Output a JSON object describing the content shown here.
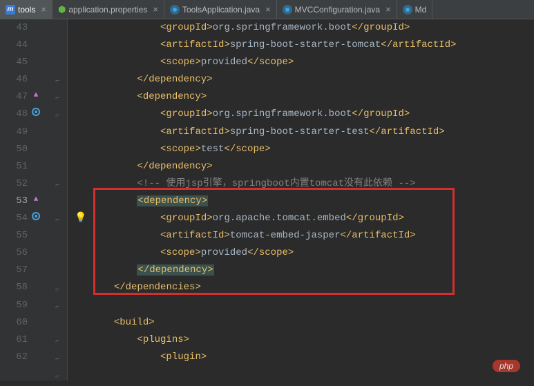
{
  "tabs": [
    {
      "label": "tools",
      "icon": "m"
    },
    {
      "label": "application.properties",
      "icon": "leaf"
    },
    {
      "label": "ToolsApplication.java",
      "icon": "java"
    },
    {
      "label": "MVCConfiguration.java",
      "icon": "java"
    },
    {
      "label": "Md",
      "icon": "java"
    }
  ],
  "gutter": {
    "start": 43,
    "end": 62,
    "current": 53
  },
  "code": {
    "l43": {
      "indent": "                    ",
      "tag_open": "<groupId>",
      "text": "org.springframework.boot",
      "tag_close": "</groupId>"
    },
    "l44": {
      "indent": "                    ",
      "tag_open": "<artifactId>",
      "text": "spring-boot-starter-tomcat",
      "tag_close": "</artifactId>"
    },
    "l45": {
      "indent": "                    ",
      "tag_open": "<scope>",
      "text": "provided",
      "tag_close": "</scope>"
    },
    "l46": {
      "indent": "                ",
      "tag": "</dependency>"
    },
    "l47": {
      "indent": "                ",
      "tag": "<dependency>"
    },
    "l48": {
      "indent": "                    ",
      "tag_open": "<groupId>",
      "text": "org.springframework.boot",
      "tag_close": "</groupId>"
    },
    "l49": {
      "indent": "                    ",
      "tag_open": "<artifactId>",
      "text": "spring-boot-starter-test",
      "tag_close": "</artifactId>"
    },
    "l50": {
      "indent": "                    ",
      "tag_open": "<scope>",
      "text": "test",
      "tag_close": "</scope>"
    },
    "l51": {
      "indent": "                ",
      "tag": "</dependency>"
    },
    "l52": {
      "indent": "                ",
      "comment": "<!-- 使用jsp引擎，springboot内置tomcat没有此依赖 -->"
    },
    "l53": {
      "indent": "                ",
      "tag": "<dependency>"
    },
    "l54": {
      "indent": "                    ",
      "tag_open": "<groupId>",
      "text": "org.apache.tomcat.embed",
      "tag_close": "</groupId>"
    },
    "l55": {
      "indent": "                    ",
      "tag_open": "<artifactId>",
      "text": "tomcat-embed-jasper",
      "tag_close": "</artifactId>"
    },
    "l56": {
      "indent": "                    ",
      "tag_open": "<scope>",
      "text": "provided",
      "tag_close": "</scope>"
    },
    "l57": {
      "indent": "                ",
      "tag": "</dependency>"
    },
    "l58": {
      "indent": "            ",
      "tag": "</dependencies>"
    },
    "l59": {
      "indent": "",
      "text": ""
    },
    "l60": {
      "indent": "            ",
      "tag": "<build>"
    },
    "l61": {
      "indent": "                ",
      "tag": "<plugins>"
    },
    "l62": {
      "indent": "                    ",
      "tag": "<plugin>"
    }
  },
  "watermark": "php"
}
